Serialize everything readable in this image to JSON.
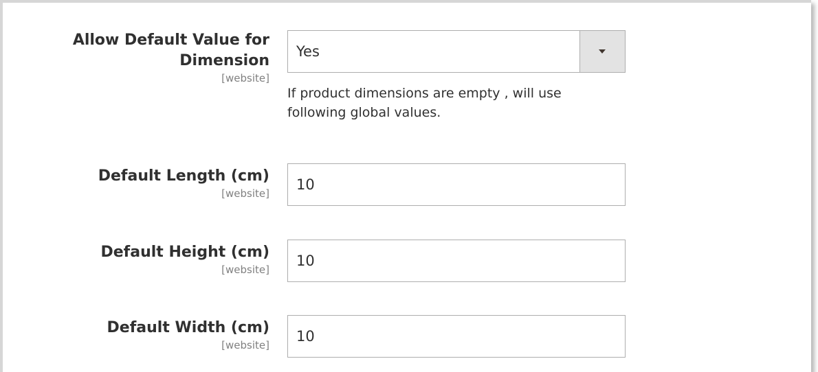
{
  "fields": {
    "allow_default": {
      "label_line1": "Allow Default Value for",
      "label_line2": "Dimension",
      "scope": "[website]",
      "value": "Yes",
      "note_line1": "If product dimensions are empty , will use",
      "note_line2": "following global values."
    },
    "length": {
      "label": "Default Length (cm)",
      "scope": "[website]",
      "value": "10"
    },
    "height": {
      "label": "Default Height (cm)",
      "scope": "[website]",
      "value": "10"
    },
    "width": {
      "label": "Default Width (cm)",
      "scope": "[website]",
      "value": "10"
    }
  },
  "icons": {
    "select_arrow": "chevron-down-icon"
  },
  "colors": {
    "text": "#303030",
    "scope": "#808080",
    "border": "#adadad",
    "arrow_bg": "#e3e3e3"
  }
}
